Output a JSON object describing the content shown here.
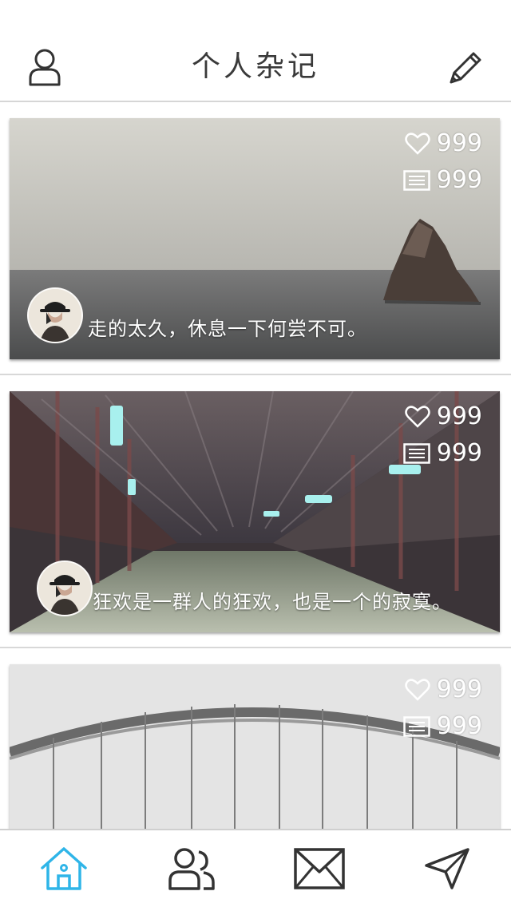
{
  "header": {
    "title": "个人杂记",
    "left_icon": "user-icon",
    "right_icon": "pencil-icon"
  },
  "colors": {
    "accent": "#2fb5e8",
    "icon": "#333333",
    "title": "#3a3a3a"
  },
  "feed": {
    "cards": [
      {
        "likes": "999",
        "comments": "999",
        "caption": "走的太久，休息一下何尝不可。"
      },
      {
        "likes": "999",
        "comments": "999",
        "caption": "狂欢是一群人的狂欢，也是一个的寂寞。"
      },
      {
        "likes": "999",
        "comments": "999",
        "caption": ""
      }
    ]
  },
  "tabbar": {
    "tabs": [
      {
        "icon": "home-icon",
        "active": true
      },
      {
        "icon": "friends-icon",
        "active": false
      },
      {
        "icon": "mail-icon",
        "active": false
      },
      {
        "icon": "send-icon",
        "active": false
      }
    ]
  }
}
